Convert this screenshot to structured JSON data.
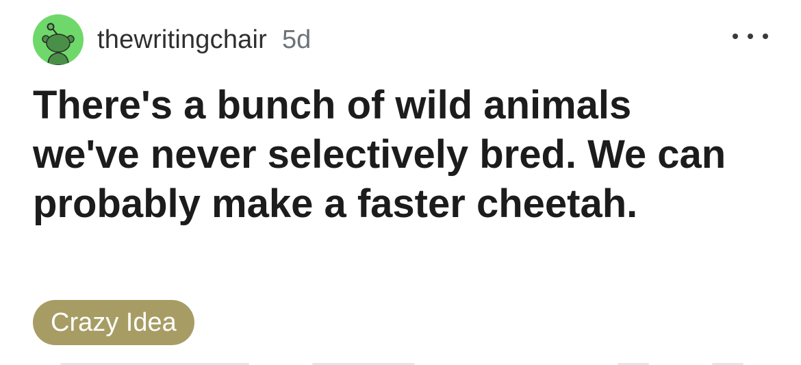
{
  "post": {
    "author": "thewritingchair",
    "age": "5d",
    "title": "There's a bunch of wild animals we've never selectively bred. We can probably make a faster cheetah.",
    "flair": {
      "label": "Crazy Idea",
      "color": "#a79d64"
    },
    "avatar": {
      "icon": "snoo-icon",
      "background": "#6fd86a"
    },
    "menu_icon": "more-options-icon"
  }
}
